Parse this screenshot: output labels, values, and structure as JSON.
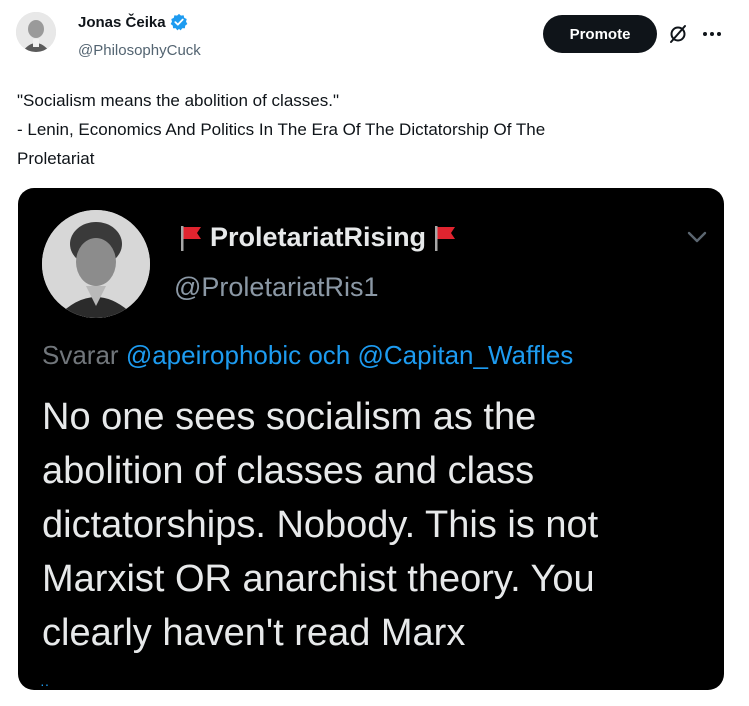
{
  "author": {
    "display_name": "Jonas Čeika",
    "handle": "@PhilosophyCuck",
    "verified": true
  },
  "actions": {
    "promote_label": "Promote"
  },
  "tweet": {
    "lines": [
      "\"Socialism means the abolition of classes.\"",
      "- Lenin, Economics And Politics In The Era Of The Dictatorship Of The",
      "Proletariat"
    ]
  },
  "embedded": {
    "display_name": "ProletariatRising",
    "handle": "@ProletariatRis1",
    "reply_prefix": "Svarar",
    "mention_1": "@apeirophobic",
    "conjunction": "och",
    "mention_2": "@Capitan_Waffles",
    "body_lines": [
      "No one sees socialism as the",
      "abolition of classes and class",
      "dictatorships. Nobody. This is not",
      "Marxist OR anarchist theory. You",
      "clearly haven't read Marx"
    ]
  },
  "colors": {
    "verified_blue": "#1d9bf0",
    "flag_red": "#e0242f",
    "mention_blue": "#1d9bf0"
  }
}
